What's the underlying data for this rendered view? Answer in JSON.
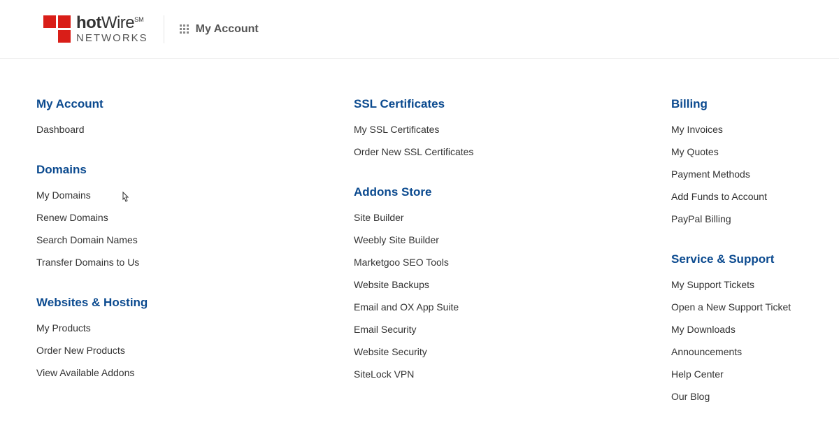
{
  "header": {
    "brand_prefix": "hot",
    "brand_suffix": "Wire",
    "brand_mark": "SM",
    "brand_sub": "NETWORKS",
    "nav_label": "My Account"
  },
  "columns": {
    "col1": {
      "my_account": {
        "title": "My Account",
        "items": [
          "Dashboard"
        ]
      },
      "domains": {
        "title": "Domains",
        "items": [
          "My Domains",
          "Renew Domains",
          "Search Domain Names",
          "Transfer Domains to Us"
        ]
      },
      "hosting": {
        "title": "Websites & Hosting",
        "items": [
          "My Products",
          "Order New Products",
          "View Available Addons"
        ]
      }
    },
    "col2": {
      "ssl": {
        "title": "SSL Certificates",
        "items": [
          "My SSL Certificates",
          "Order New SSL Certificates"
        ]
      },
      "addons": {
        "title": "Addons Store",
        "items": [
          "Site Builder",
          "Weebly Site Builder",
          "Marketgoo SEO Tools",
          "Website Backups",
          "Email and OX App Suite",
          "Email Security",
          "Website Security",
          "SiteLock VPN"
        ]
      }
    },
    "col3": {
      "billing": {
        "title": "Billing",
        "items": [
          "My Invoices",
          "My Quotes",
          "Payment Methods",
          "Add Funds to Account",
          "PayPal Billing"
        ]
      },
      "support": {
        "title": "Service & Support",
        "items": [
          "My Support Tickets",
          "Open a New Support Ticket",
          "My Downloads",
          "Announcements",
          "Help Center",
          "Our Blog"
        ]
      }
    }
  }
}
